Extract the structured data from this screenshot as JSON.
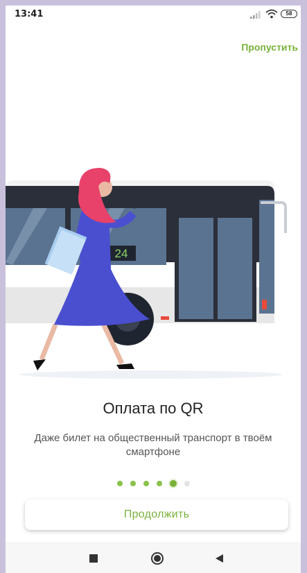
{
  "status": {
    "time": "13:41",
    "battery": "58"
  },
  "header": {
    "skip_label": "Пропустить"
  },
  "illustration": {
    "bus_route_number": "24"
  },
  "content": {
    "title": "Оплата по QR",
    "subtitle": "Даже билет на общественный транспорт в твоём смартфоне"
  },
  "pagination": {
    "total": 6,
    "active_index": 4
  },
  "actions": {
    "continue_label": "Продолжить"
  },
  "icons": {
    "signal": "signal-bars-icon",
    "wifi": "wifi-icon",
    "battery": "battery-icon",
    "nav_recent": "square-stop-icon",
    "nav_home": "circle-home-icon",
    "nav_back": "triangle-back-icon"
  },
  "colors": {
    "accent": "#7ab23a",
    "dress": "#4a4fd0",
    "hair": "#e8416a",
    "bus_dark": "#2b2f3a",
    "bus_window": "#5a7390"
  }
}
